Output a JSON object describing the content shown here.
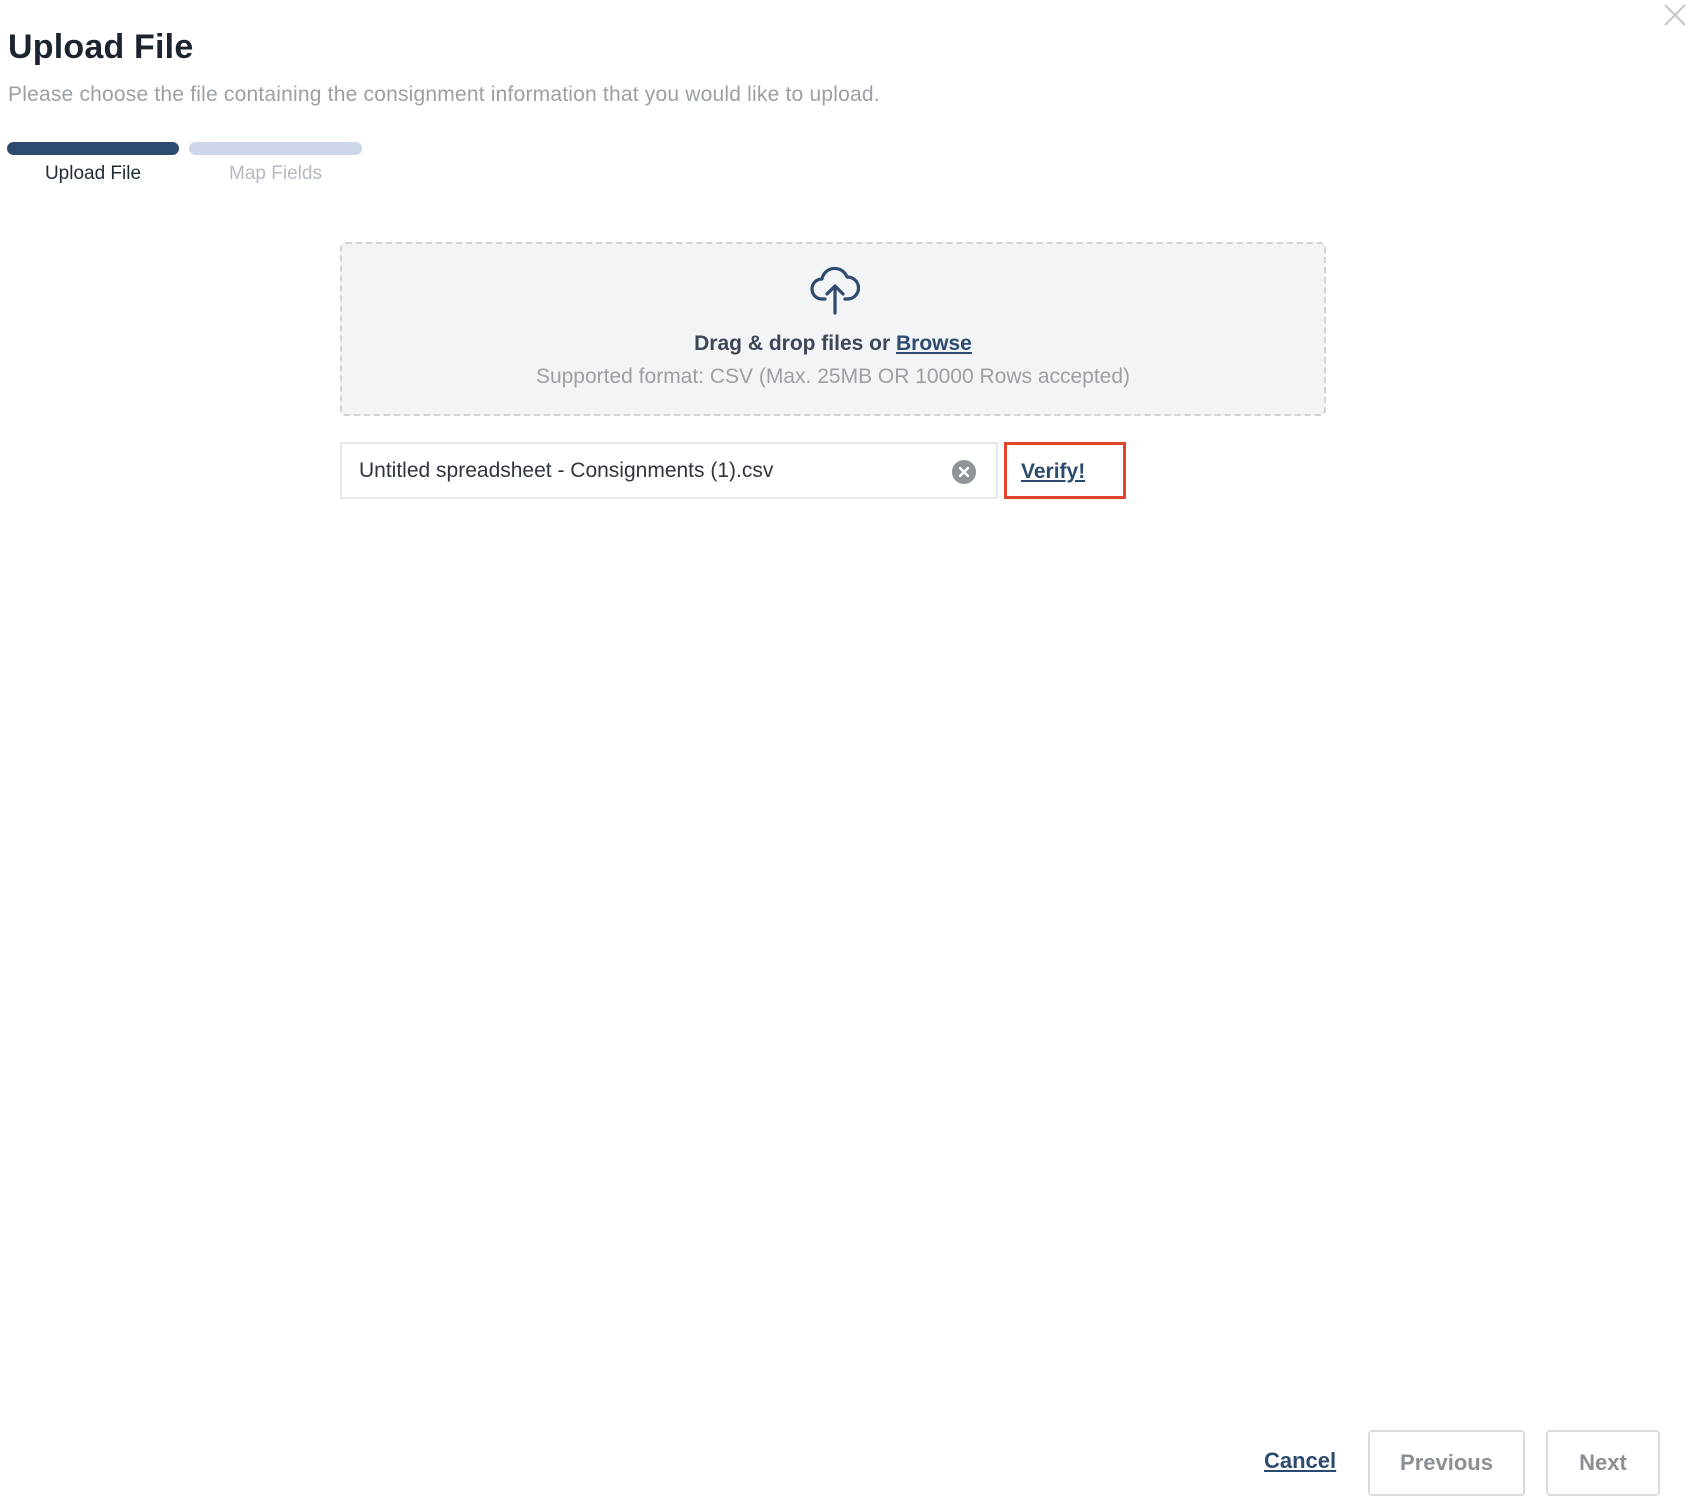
{
  "dialog": {
    "title": "Upload File",
    "subtitle": "Please choose the file containing the consignment information that you would like to upload."
  },
  "steps": [
    {
      "label": "Upload File",
      "state": "active"
    },
    {
      "label": "Map Fields",
      "state": "inactive"
    }
  ],
  "dropzone": {
    "icon": "cloud-upload-icon",
    "prompt_prefix": "Drag & drop files or ",
    "browse_label": "Browse",
    "supported_text": "Supported format: CSV (Max. 25MB OR 10000 Rows accepted)"
  },
  "file": {
    "name": "Untitled spreadsheet - Consignments (1).csv",
    "clear_icon": "clear-circle-icon",
    "verify_label": "Verify!"
  },
  "footer": {
    "cancel_label": "Cancel",
    "previous_label": "Previous",
    "next_label": "Next"
  },
  "colors": {
    "primary": "#2d4a6f",
    "step_inactive": "#cdd6e8",
    "highlight": "#e0452b",
    "dropzone_bg": "#f3f4f6"
  }
}
